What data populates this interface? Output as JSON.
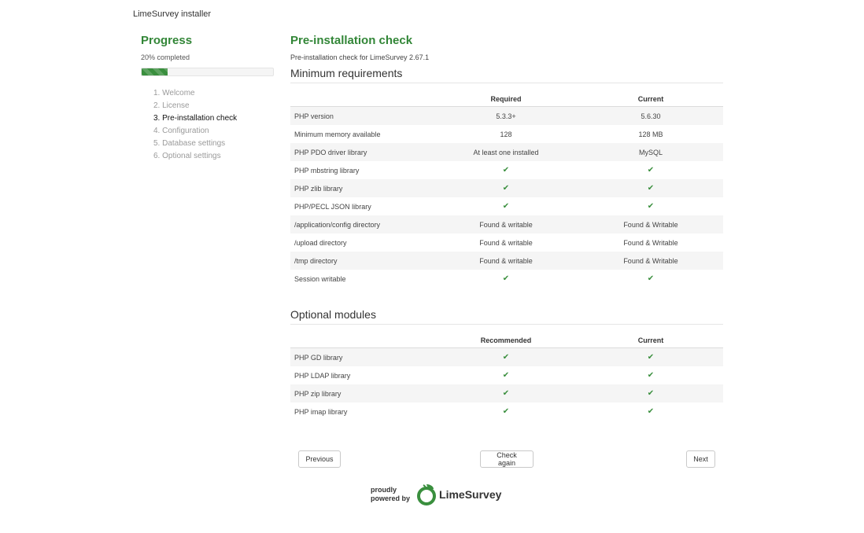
{
  "app_title": "LimeSurvey installer",
  "sidebar": {
    "title": "Progress",
    "progress_text": "20% completed",
    "progress_fraction": 0.2,
    "steps": [
      {
        "label": "1. Welcome"
      },
      {
        "label": "2. License"
      },
      {
        "label": "3. Pre-installation check"
      },
      {
        "label": "4. Configuration"
      },
      {
        "label": "5. Database settings"
      },
      {
        "label": "6. Optional settings"
      }
    ]
  },
  "main": {
    "title": "Pre-installation check",
    "subtitle": "Pre-installation check for LimeSurvey 2.67.1",
    "minimum": {
      "title": "Minimum requirements",
      "headers": [
        "",
        "Required",
        "Current"
      ],
      "rows": [
        [
          "PHP version",
          "5.3.3+",
          "5.6.30"
        ],
        [
          "Minimum memory available",
          "128",
          "128 MB"
        ],
        [
          "PHP PDO driver library",
          "At least one installed",
          "MySQL"
        ],
        [
          "PHP mbstring library",
          "✔",
          "✔"
        ],
        [
          "PHP zlib library",
          "✔",
          "✔"
        ],
        [
          "PHP/PECL JSON library",
          "✔",
          "✔"
        ],
        [
          "/application/config directory",
          "Found & writable",
          "Found & Writable"
        ],
        [
          "/upload directory",
          "Found & writable",
          "Found & Writable"
        ],
        [
          "/tmp directory",
          "Found & writable",
          "Found & Writable"
        ],
        [
          "Session writable",
          "✔",
          "✔"
        ]
      ]
    },
    "optional": {
      "title": "Optional modules",
      "headers": [
        "",
        "Recommended",
        "Current"
      ],
      "rows": [
        [
          "PHP GD library",
          "✔",
          "✔"
        ],
        [
          "PHP LDAP library",
          "✔",
          "✔"
        ],
        [
          "PHP zip library",
          "✔",
          "✔"
        ],
        [
          "PHP imap library",
          "✔",
          "✔"
        ]
      ]
    }
  },
  "buttons": {
    "previous": "Previous",
    "check_again": "Check again",
    "next": "Next"
  },
  "footer": {
    "powered_line1": "proudly",
    "powered_line2": "powered by",
    "brand": "LimeSurvey"
  },
  "colors": {
    "accent": "#328637",
    "check": "#3a8f3e"
  }
}
